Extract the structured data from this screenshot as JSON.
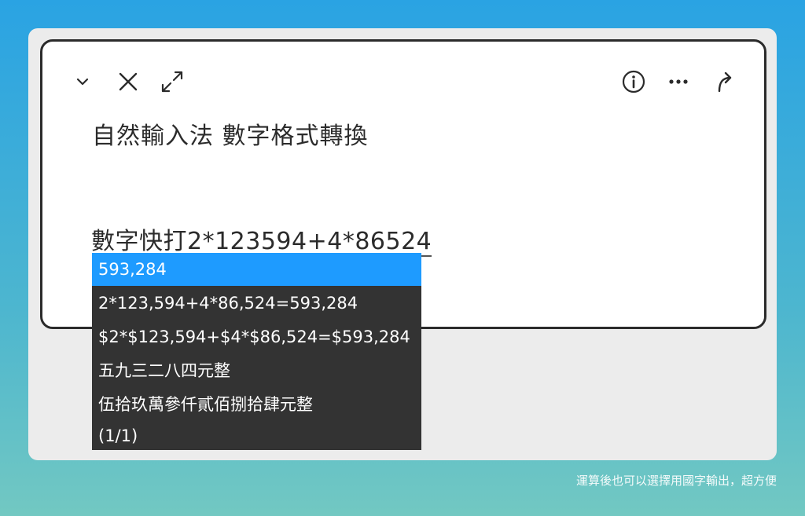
{
  "toolbar": {
    "left_icons": [
      "chevron-down-icon",
      "close-icon",
      "expand-icon"
    ],
    "right_icons": [
      "info-icon",
      "more-icon",
      "share-icon"
    ]
  },
  "title": "自然輸入法 數字格式轉換",
  "input": {
    "prefix": "數字快打",
    "composing": "2*123594+4*86524"
  },
  "candidates": {
    "items": [
      "593,284",
      "2*123,594+4*86,524=593,284",
      "$2*$123,594+$4*$86,524=$593,284",
      "五九三二八四元整",
      "伍拾玖萬參仟貳佰捌拾肆元整"
    ],
    "selected_index": 0,
    "page": "(1/1)"
  },
  "caption": "運算後也可以選擇用國字輸出，超方便",
  "colors": {
    "selection": "#1e9bff",
    "candidate_bg": "#333333",
    "panel_border": "#2b2b2b"
  }
}
